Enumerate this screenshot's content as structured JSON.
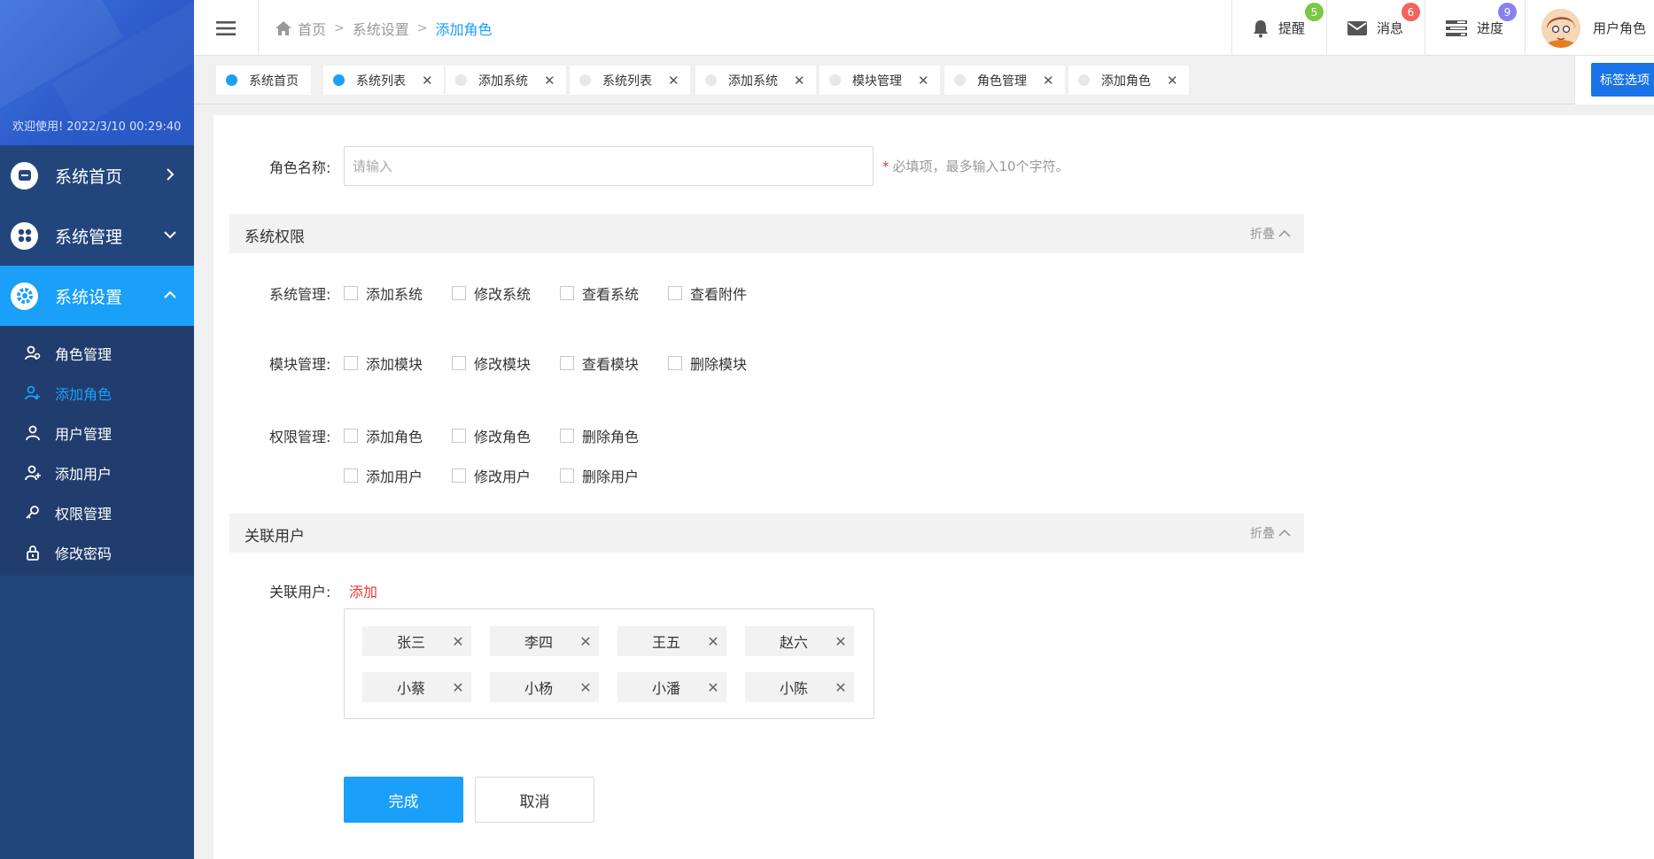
{
  "sidebar": {
    "welcome_text": "欢迎使用!",
    "welcome_time": "2022/3/10 00:29:40",
    "nav": [
      {
        "label": "系统首页"
      },
      {
        "label": "系统管理"
      },
      {
        "label": "系统设置"
      }
    ],
    "sub_items": [
      {
        "label": "角色管理"
      },
      {
        "label": "添加角色"
      },
      {
        "label": "用户管理"
      },
      {
        "label": "添加用户"
      },
      {
        "label": "权限管理"
      },
      {
        "label": "修改密码"
      }
    ]
  },
  "header": {
    "breadcrumb": [
      "首页",
      "系统设置",
      "添加角色"
    ],
    "reminder": {
      "label": "提醒",
      "count": "5",
      "color": "#7ac943"
    },
    "messages": {
      "label": "消息",
      "count": "6",
      "color": "#f2655a"
    },
    "progress": {
      "label": "进度",
      "count": "9",
      "color": "#8a7ff0"
    },
    "user_label": "用户角色"
  },
  "tabs": [
    {
      "label": "系统首页",
      "active": true,
      "closable": false
    },
    {
      "label": "系统列表",
      "active": true,
      "closable": true
    },
    {
      "label": "添加系统",
      "active": false,
      "closable": true
    },
    {
      "label": "系统列表",
      "active": false,
      "closable": true
    },
    {
      "label": "添加系统",
      "active": false,
      "closable": true
    },
    {
      "label": "模块管理",
      "active": false,
      "closable": true
    },
    {
      "label": "角色管理",
      "active": false,
      "closable": true
    },
    {
      "label": "添加角色",
      "active": false,
      "closable": true
    }
  ],
  "tab_options_label": "标签选项",
  "form": {
    "role_name_label": "角色名称:",
    "role_name_placeholder": "请输入",
    "role_name_hint_mark": "*",
    "role_name_hint": "必填项，最多输入10个字符。",
    "perm_section_title": "系统权限",
    "collapse_label": "折叠",
    "perm_groups": [
      {
        "label": "系统管理:",
        "options": [
          "添加系统",
          "修改系统",
          "查看系统",
          "查看附件"
        ]
      },
      {
        "label": "模块管理:",
        "options": [
          "添加模块",
          "修改模块",
          "查看模块",
          "删除模块"
        ]
      },
      {
        "label": "权限管理:",
        "options": [
          "添加角色",
          "修改角色",
          "删除角色",
          "添加用户",
          "修改用户",
          "删除用户"
        ]
      }
    ],
    "users_section_title": "关联用户",
    "users_label": "关联用户:",
    "add_label": "添加",
    "users": [
      "张三",
      "李四",
      "王五",
      "赵六",
      "小蔡",
      "小杨",
      "小潘",
      "小陈"
    ],
    "submit_label": "完成",
    "cancel_label": "取消"
  },
  "colors": {
    "accent": "#1aa0f8",
    "sidebar_bg": "#22467c",
    "required": "#e53935"
  }
}
